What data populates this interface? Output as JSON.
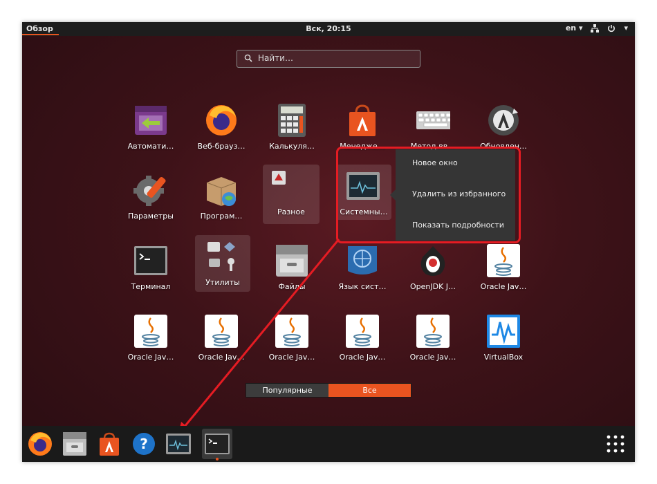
{
  "topbar": {
    "activities": "Обзор",
    "clock": "Вск, 20:15",
    "lang": "en"
  },
  "search": {
    "placeholder": "Найти…"
  },
  "apps": [
    {
      "label": "Автомати…",
      "icon": "automation-icon"
    },
    {
      "label": "Веб-брауз…",
      "icon": "firefox-icon"
    },
    {
      "label": "Калькуля…",
      "icon": "calculator-icon"
    },
    {
      "label": "Менедже…",
      "icon": "software-center-icon"
    },
    {
      "label": "Метод вв…",
      "icon": "keyboard-icon"
    },
    {
      "label": "Обновлен…",
      "icon": "software-updater-icon"
    },
    {
      "label": "Параметры",
      "icon": "settings-icon"
    },
    {
      "label": "Програм…",
      "icon": "software-properties-icon"
    },
    {
      "label": "Разное",
      "icon": "misc-folder-icon"
    },
    {
      "label": "Системны…",
      "icon": "system-monitor-icon"
    },
    {
      "label": "Терминал",
      "icon": "terminal-icon"
    },
    {
      "label": "Утилиты",
      "icon": "utilities-folder-icon"
    },
    {
      "label": "Файлы",
      "icon": "files-icon"
    },
    {
      "label": "Язык сист…",
      "icon": "language-icon"
    },
    {
      "label": "OpenJDK J…",
      "icon": "openjdk-icon"
    },
    {
      "label": "Oracle Jav…",
      "icon": "java-icon"
    },
    {
      "label": "Oracle Jav…",
      "icon": "java-icon"
    },
    {
      "label": "Oracle Jav…",
      "icon": "java-icon"
    },
    {
      "label": "Oracle Jav…",
      "icon": "java-icon"
    },
    {
      "label": "Oracle Jav…",
      "icon": "java-icon"
    },
    {
      "label": "Oracle Jav…",
      "icon": "java-icon"
    },
    {
      "label": "VirtualBox",
      "icon": "virtualbox-icon"
    }
  ],
  "context_menu": {
    "new_window": "Новое окно",
    "remove_favorite": "Удалить из избранного",
    "show_details": "Показать подробности"
  },
  "tabs": {
    "popular": "Популярные",
    "all": "Все"
  },
  "dock": [
    "firefox-icon",
    "files-icon",
    "software-center-icon",
    "help-icon",
    "system-monitor-icon",
    "terminal-icon",
    "show-apps-icon"
  ],
  "colors": {
    "accent": "#e95420",
    "annotation": "#e51c23"
  }
}
